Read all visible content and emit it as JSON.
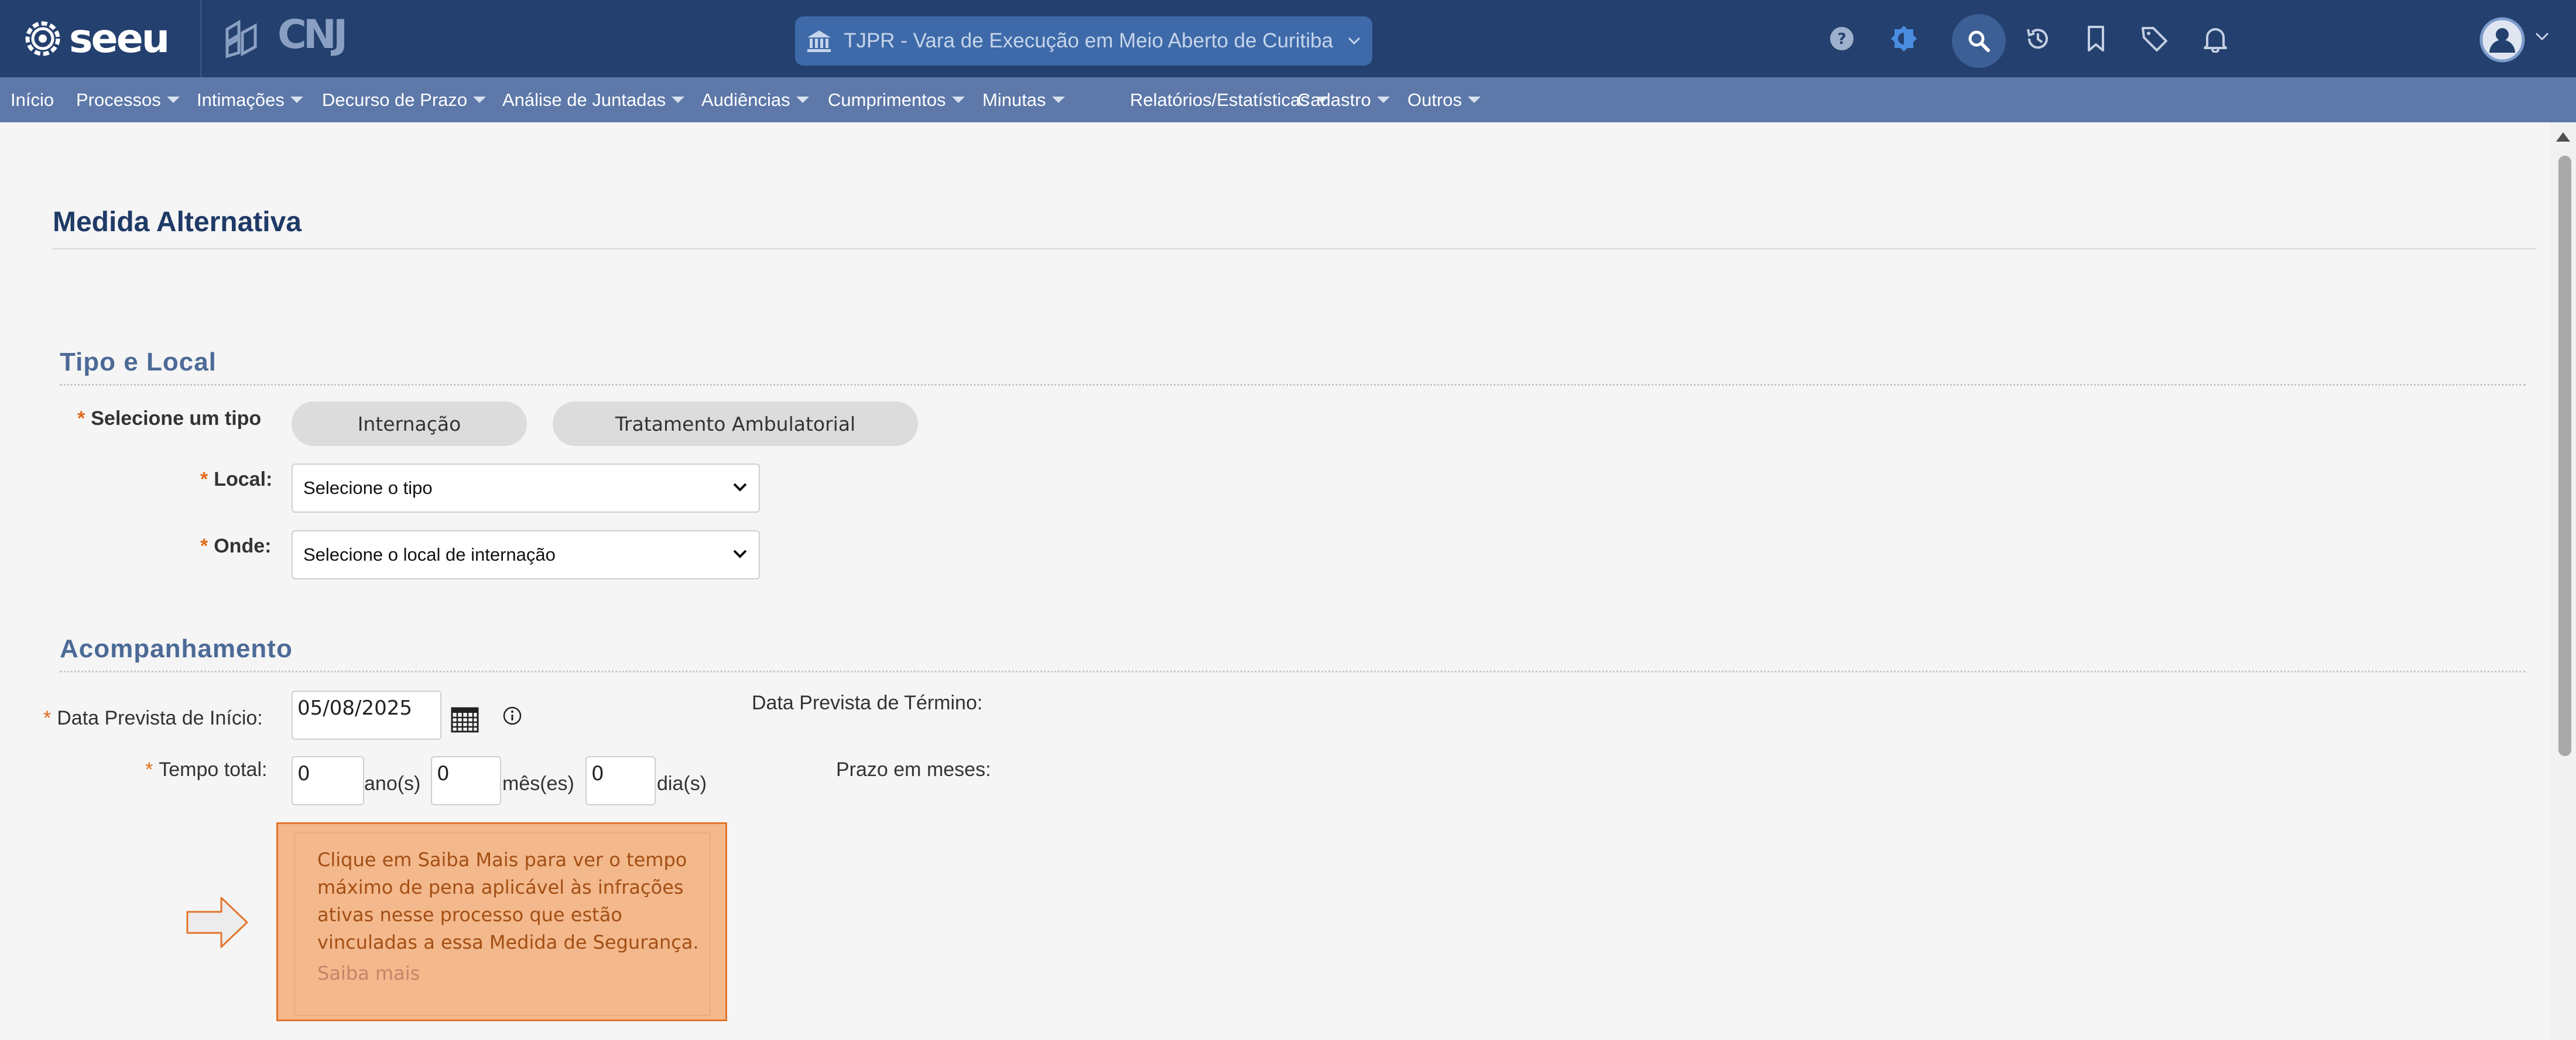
{
  "header": {
    "logo_text": "seeu",
    "cnj_text": "CNJ",
    "court_selector": "TJPR - Vara de Execução em Meio Aberto de Curitiba",
    "icons": [
      "help-icon",
      "theme-icon",
      "search-icon",
      "history-icon",
      "bookmark-icon",
      "tag-icon",
      "notification-icon",
      "user-avatar-icon"
    ]
  },
  "menu": {
    "items": [
      {
        "label": "Início",
        "dropdown": false
      },
      {
        "label": "Processos",
        "dropdown": true
      },
      {
        "label": "Intimações",
        "dropdown": true
      },
      {
        "label": "Decurso de Prazo",
        "dropdown": true
      },
      {
        "label": "Análise de Juntadas",
        "dropdown": true
      },
      {
        "label": "Audiências",
        "dropdown": true
      },
      {
        "label": "Cumprimentos",
        "dropdown": true
      },
      {
        "label": "Minutas",
        "dropdown": true
      },
      {
        "label": "Relatórios/Estatísticas",
        "dropdown": true
      },
      {
        "label": "Cadastro",
        "dropdown": true
      },
      {
        "label": "Outros",
        "dropdown": true
      }
    ]
  },
  "page": {
    "title": "Medida Alternativa"
  },
  "tipo_local": {
    "heading": "Tipo e Local",
    "tipo_label": "Selecione um tipo",
    "tipo_options": [
      "Internação",
      "Tratamento Ambulatorial"
    ],
    "local_label": "Local:",
    "local_value": "Selecione o tipo",
    "onde_label": "Onde:",
    "onde_value": "Selecione o local de internação"
  },
  "acompanhamento": {
    "heading": "Acompanhamento",
    "data_inicio_label": "Data Prevista de Início:",
    "data_inicio_value": "05/08/2025",
    "tempo_total_label": "Tempo total:",
    "anos_value": "0",
    "anos_unit": "ano(s)",
    "meses_value": "0",
    "meses_unit": "mês(es)",
    "dias_value": "0",
    "dias_unit": "dia(s)",
    "data_termino_label": "Data Prevista de Término:",
    "prazo_meses_label": "Prazo em meses:"
  },
  "tip": {
    "text": "Clique em Saiba Mais para ver o tempo máximo de pena aplicável às infrações ativas nesse processo que estão vinculadas a essa Medida de Segurança.",
    "link": "Saiba mais"
  },
  "colors": {
    "header_bg": "#24406e",
    "menu_bg": "#5d78a9",
    "accent": "#e06b18",
    "tip_bg": "#f3b88c"
  }
}
